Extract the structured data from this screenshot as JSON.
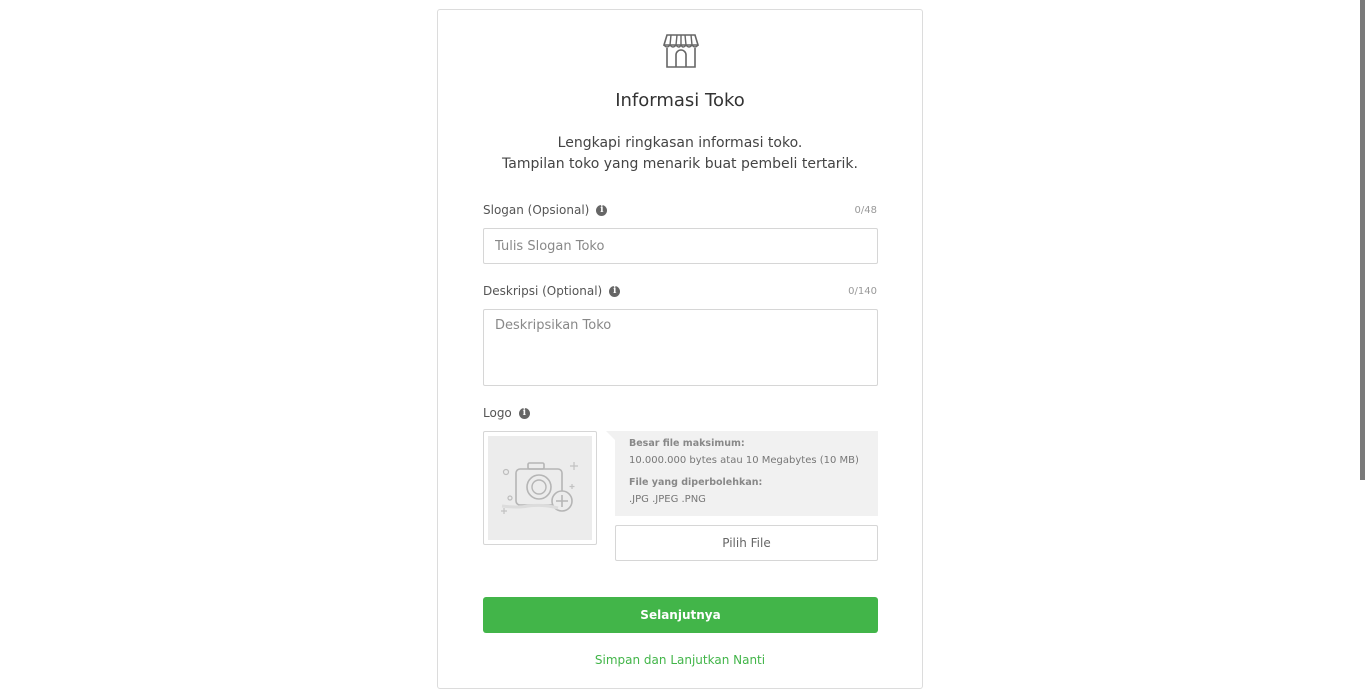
{
  "header": {
    "icon": "store-icon",
    "title": "Informasi Toko",
    "subtitle_line1": "Lengkapi ringkasan informasi toko.",
    "subtitle_line2": "Tampilan toko yang menarik buat pembeli tertarik."
  },
  "slogan": {
    "label": "Slogan (Opsional)",
    "counter": "0/48",
    "placeholder": "Tulis Slogan Toko",
    "value": ""
  },
  "description": {
    "label": "Deskripsi (Optional)",
    "counter": "0/140",
    "placeholder": "Deskripsikan Toko",
    "value": ""
  },
  "logo": {
    "label": "Logo",
    "placeholder_icon": "camera-add-icon",
    "max_size_heading": "Besar file maksimum:",
    "max_size_value": "10.000.000 bytes atau 10 Megabytes (10 MB)",
    "allowed_heading": "File yang diperbolehkan:",
    "allowed_value": ".JPG .JPEG .PNG",
    "pick_button": "Pilih File"
  },
  "actions": {
    "next_button": "Selanjutnya",
    "save_later_link": "Simpan dan Lanjutkan Nanti"
  },
  "colors": {
    "accent": "#42b549",
    "border": "#d6d6d6",
    "info_bg": "#f1f1f1"
  }
}
